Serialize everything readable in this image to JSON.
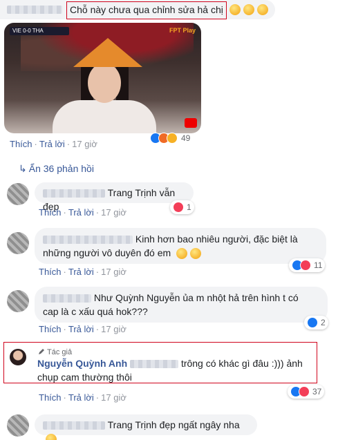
{
  "top_comment": {
    "text": "Chỗ này chưa qua chỉnh sửa hả chị",
    "actions": {
      "like": "Thích",
      "reply": "Trả lời",
      "time": "17 giờ"
    },
    "reaction_count": "49"
  },
  "photo": {
    "scoreboard": "VIE 0-0 THA",
    "broadcaster": "FPT Play"
  },
  "hidden_replies": "Ẩn 36 phản hồi",
  "replies": [
    {
      "mention": "Trang Trịnh",
      "text": "vẫn đẹp",
      "reaction_count": "1",
      "time": "17 giờ"
    },
    {
      "line1": "Kinh hơn bao nhiêu người, đặc biệt là",
      "line2": "những người vô duyên đó em",
      "reaction_count": "11",
      "time": "17 giờ"
    },
    {
      "mention": "Như Quỳnh Nguyễn",
      "line1": "ủa m nhột hả trên hình t có",
      "line2": "cap là c xấu quá hok???",
      "reaction_count": "2",
      "time": "17 giờ"
    },
    {
      "author_tag": "Tác giả",
      "author": "Nguyễn Quỳnh Anh",
      "line1": "trông có khác gì đâu :))) ảnh",
      "line2": "chụp cam thường thôi",
      "reaction_count": "37",
      "time": "17 giờ"
    },
    {
      "mention": "Trang Trịnh",
      "text": "đẹp ngất ngây nha"
    }
  ],
  "labels": {
    "like": "Thích",
    "reply": "Trả lời",
    "dot": "·"
  },
  "colors": {
    "link": "#385898",
    "highlight": "#d0021b",
    "bubble": "#f2f3f5"
  }
}
